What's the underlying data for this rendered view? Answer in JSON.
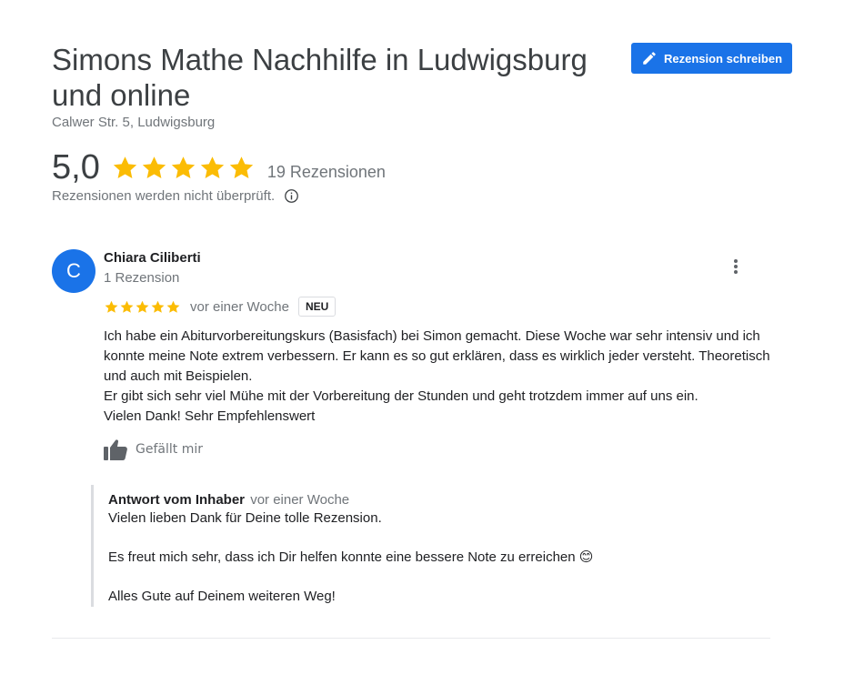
{
  "place": {
    "title": "Simons Mathe Nachhilfe in Ludwigsburg und online",
    "address": "Calwer Str. 5, Ludwigsburg"
  },
  "actions": {
    "write_review_label": "Rezension schreiben"
  },
  "summary": {
    "rating": "5,0",
    "stars": 5,
    "review_count": "19 Rezensionen",
    "unverified_note": "Rezensionen werden nicht überprüft."
  },
  "review": {
    "avatar_letter": "C",
    "reviewer_name": "Chiara Ciliberti",
    "reviewer_meta": "1 Rezension",
    "stars": 5,
    "date": "vor einer Woche",
    "badge": "NEU",
    "text_lines": [
      "Ich habe ein Abiturvorbereitungskurs (Basisfach) bei Simon gemacht. Diese Woche war sehr intensiv und ich konnte meine Note extrem verbessern. Er kann es so gut erklären, dass es wirklich jeder versteht. Theoretisch und auch mit Beispielen.",
      "Er gibt sich sehr viel Mühe mit der Vorbereitung der Stunden und geht trotzdem immer auf uns ein.",
      "Vielen Dank! Sehr Empfehlenswert"
    ],
    "like_label": "Gefällt mir"
  },
  "owner_reply": {
    "label": "Antwort vom Inhaber",
    "date": "vor einer Woche",
    "lines": [
      "Vielen lieben Dank für Deine tolle Rezension.",
      "",
      "Es freut mich sehr, dass ich Dir helfen konnte eine bessere Note zu erreichen 😊",
      "",
      "Alles Gute auf Deinem weiteren Weg!"
    ]
  },
  "colors": {
    "accent": "#1a73e8",
    "star": "#fbbc04",
    "muted_text": "#70757a"
  },
  "icons": {
    "write": "pencil-icon",
    "star": "star-icon",
    "info": "info-icon",
    "more": "more-vert-icon",
    "like": "thumb-up-icon"
  }
}
